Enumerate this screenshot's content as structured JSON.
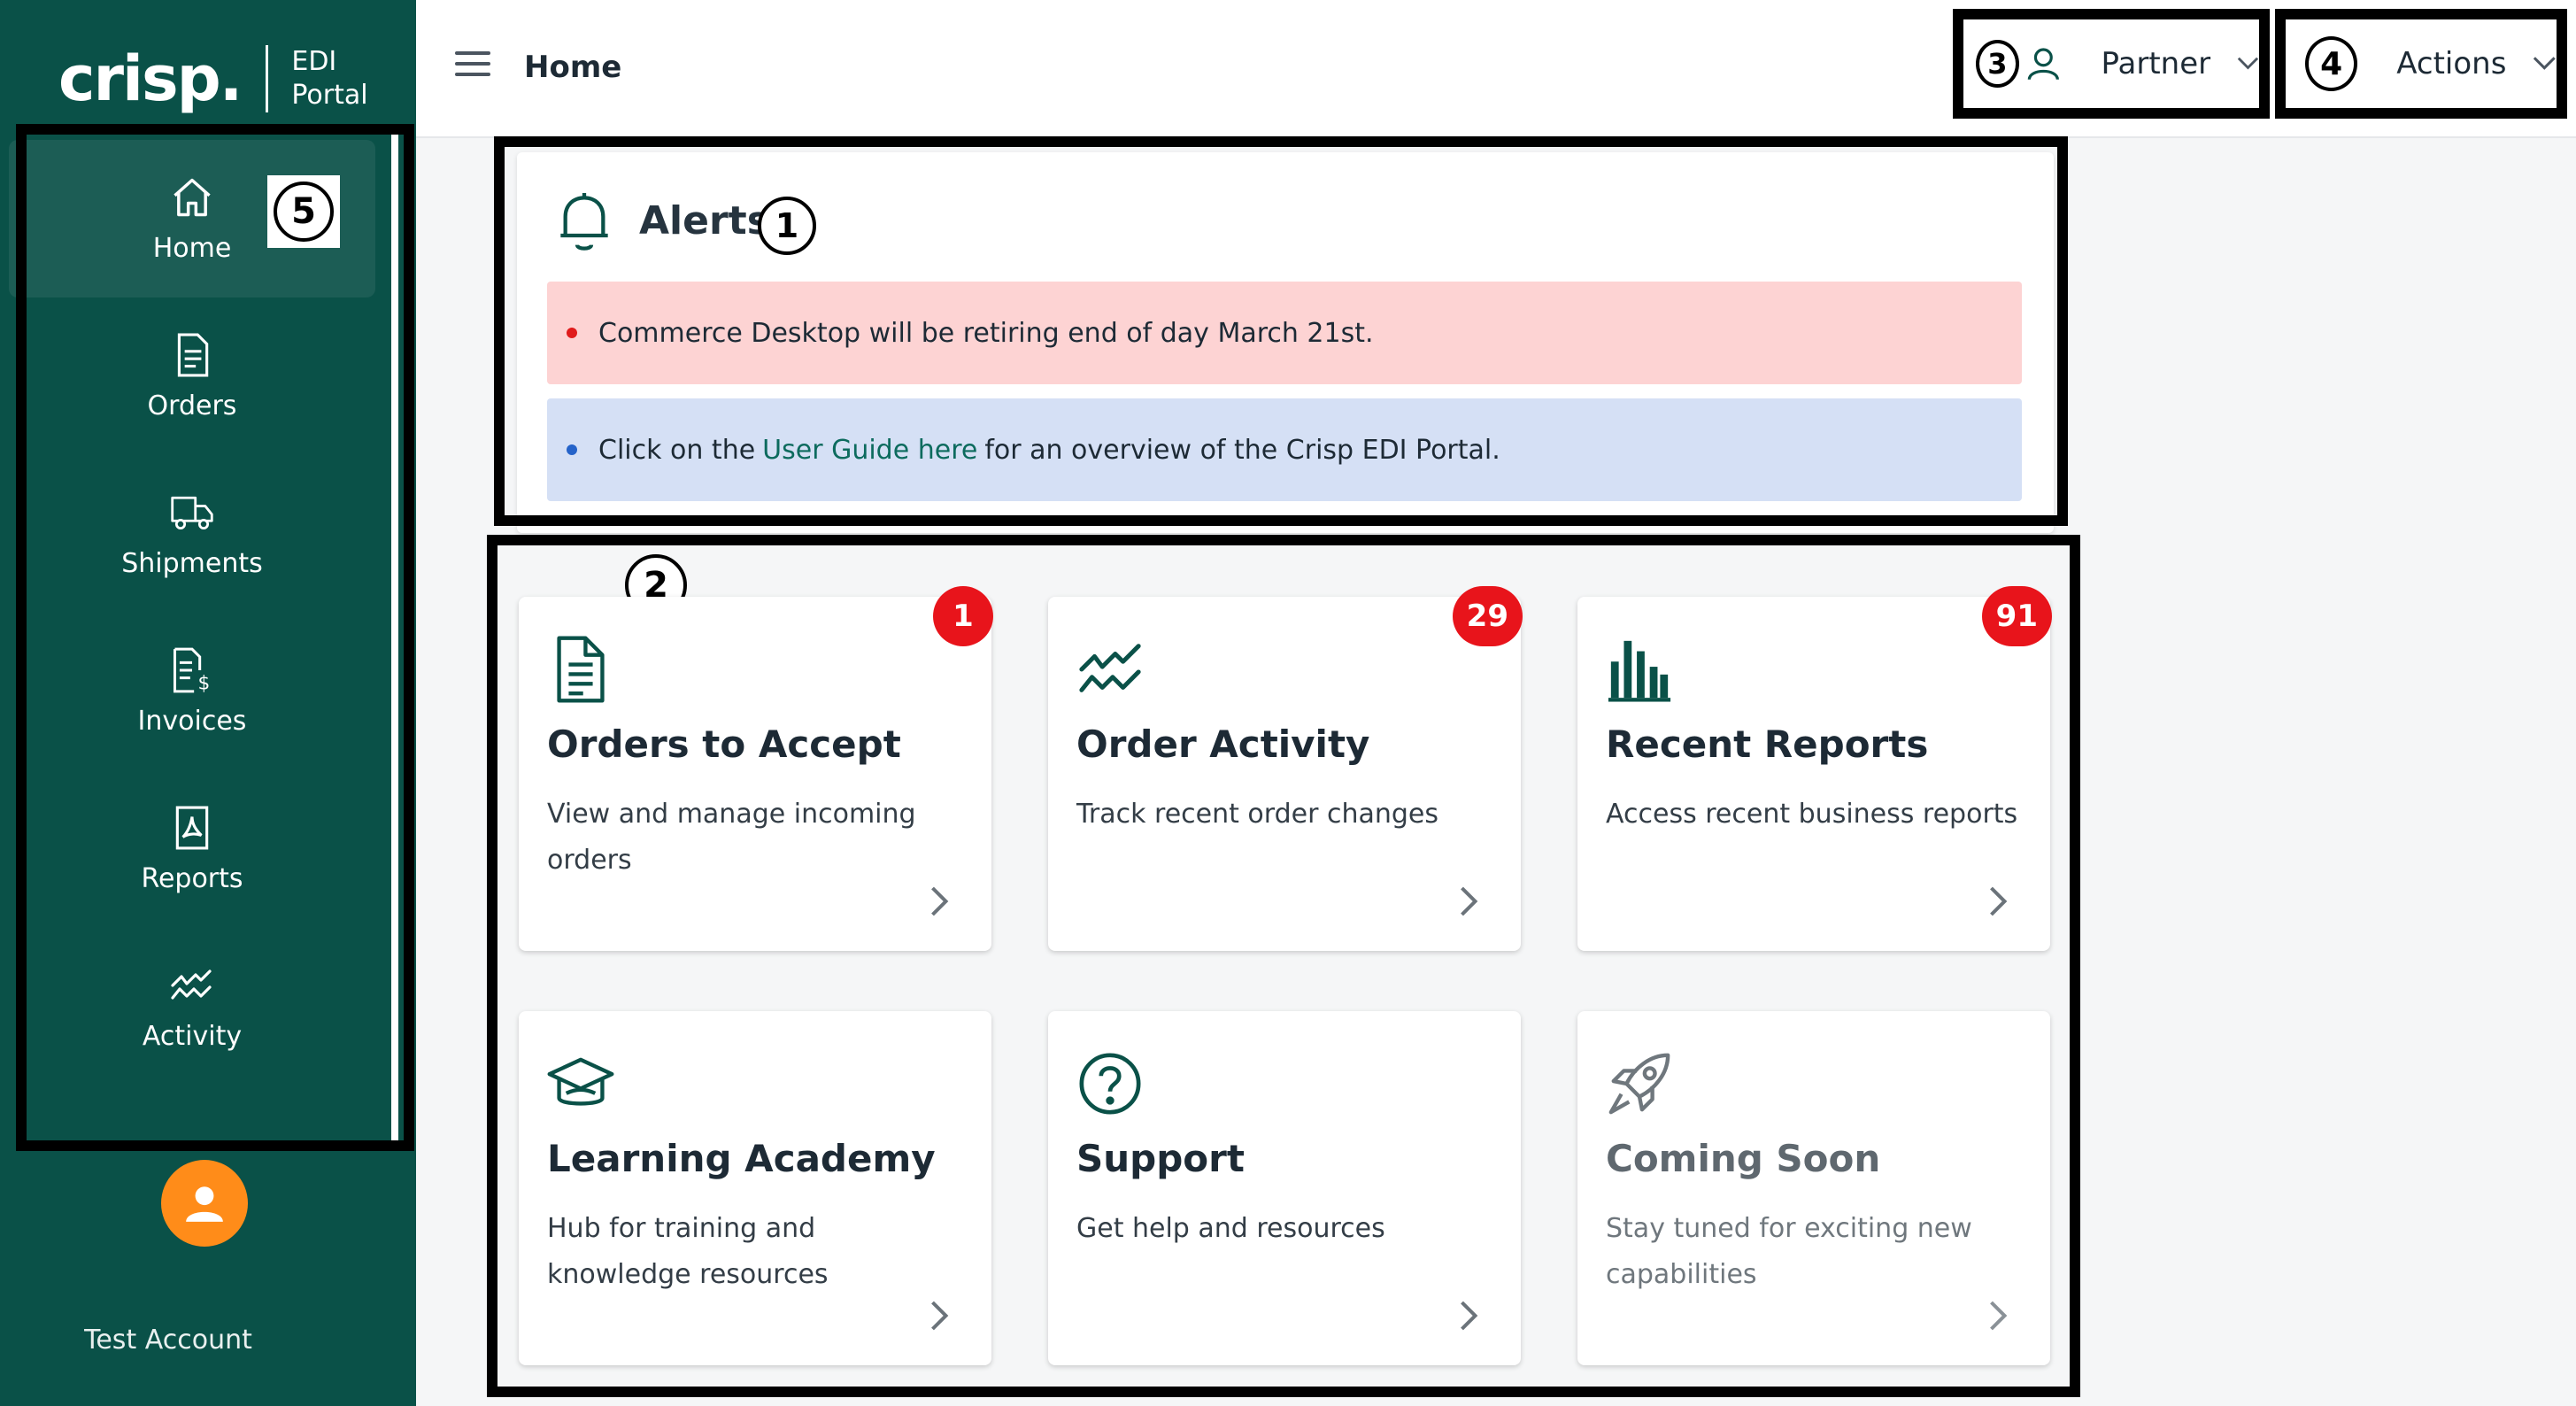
{
  "brand": {
    "logo": "crisp.",
    "sub_line1": "EDI",
    "sub_line2": "Portal"
  },
  "sidebar": {
    "items": [
      {
        "label": "Home",
        "icon": "home-icon"
      },
      {
        "label": "Orders",
        "icon": "orders-icon"
      },
      {
        "label": "Shipments",
        "icon": "truck-icon"
      },
      {
        "label": "Invoices",
        "icon": "invoice-icon"
      },
      {
        "label": "Reports",
        "icon": "pdf-report-icon"
      },
      {
        "label": "Activity",
        "icon": "activity-icon"
      }
    ],
    "account_name": "Test Account"
  },
  "header": {
    "title": "Home",
    "partner_label": "Partner",
    "actions_label": "Actions"
  },
  "markers": {
    "m1": "1",
    "m2": "2",
    "m3": "3",
    "m4": "4",
    "m5": "5"
  },
  "alerts": {
    "title": "Alerts",
    "red_text": "Commerce Desktop will be retiring end of day March 21st.",
    "blue_before": "Click on the",
    "blue_link": "User Guide here",
    "blue_after": "for an overview of the Crisp EDI Portal."
  },
  "tiles": [
    {
      "title": "Orders to Accept",
      "desc": "View and manage incoming orders",
      "badge": "1",
      "icon": "document-icon"
    },
    {
      "title": "Order Activity",
      "desc": "Track recent order changes",
      "badge": "29",
      "icon": "activity-icon"
    },
    {
      "title": "Recent Reports",
      "desc": "Access recent business reports",
      "badge": "91",
      "icon": "bar-chart-icon"
    },
    {
      "title": "Learning Academy",
      "desc": "Hub for training and knowledge resources",
      "icon": "graduation-cap-icon"
    },
    {
      "title": "Support",
      "desc": "Get help and resources",
      "icon": "help-circle-icon"
    },
    {
      "title": "Coming Soon",
      "desc": "Stay tuned for exciting new capabilities",
      "icon": "rocket-icon"
    }
  ],
  "colors": {
    "sidebar_bg": "#0a5148",
    "accent": "#0d6b5e",
    "badge": "#e8141b",
    "avatar": "#ff8c19",
    "alert_red_bg": "#fdd3d3",
    "alert_blue_bg": "#d5e0f5"
  }
}
